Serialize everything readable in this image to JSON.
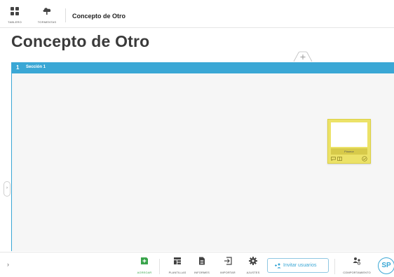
{
  "topbar": {
    "nav": [
      {
        "label": "TABLERO",
        "icon": "grid-icon"
      },
      {
        "label": "TORMENTAS",
        "icon": "cloud-icon"
      }
    ],
    "breadcrumb": "Concepto de Otro"
  },
  "page": {
    "title": "Concepto de Otro"
  },
  "section": {
    "number": "1",
    "name": "Sección 1",
    "color": "#3aa7d5"
  },
  "note": {
    "label": "Pósmor",
    "color": "#ece268"
  },
  "toolbar": {
    "add_label": "AGREGAR",
    "templates_label": "PLANTILLAS",
    "reports_label": "INFORMES",
    "import_label": "IMPORTAR",
    "settings_label": "AJUSTES",
    "invite_label": "Invitar usuarios",
    "behavior_label": "COMPORTAMIENTO",
    "avatar_initials": "SP",
    "accent": "#3aa7d5",
    "add_color": "#39a44b"
  }
}
